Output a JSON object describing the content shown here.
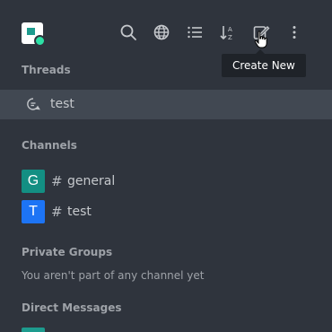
{
  "tooltip": {
    "text": "Create New"
  },
  "sections": {
    "threads": {
      "title": "Threads",
      "items": [
        {
          "label": "test"
        }
      ]
    },
    "channels": {
      "title": "Channels",
      "items": [
        {
          "avatar_letter": "G",
          "avatar_color": "#138f83",
          "name": "general"
        },
        {
          "avatar_letter": "T",
          "avatar_color": "#1d74f5",
          "name": "test"
        }
      ]
    },
    "private_groups": {
      "title": "Private Groups",
      "empty_text": "You aren't part of any channel yet"
    },
    "direct_messages": {
      "title": "Direct Messages"
    }
  },
  "header_icons": [
    "search-icon",
    "directory-globe-icon",
    "view-mode-list-icon",
    "sort-icon",
    "create-new-icon",
    "kebab-menu-icon"
  ],
  "colors": {
    "background": "#2f343d",
    "selected_row": "#414852",
    "tooltip_bg": "#1f2329",
    "status_online": "#2de0a5"
  }
}
